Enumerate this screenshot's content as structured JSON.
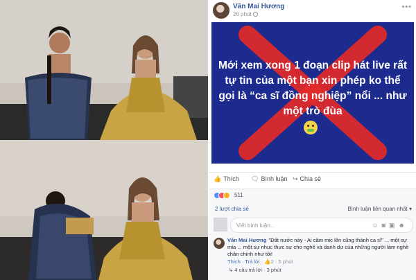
{
  "post": {
    "author": "Văn Mai Hương",
    "time": "26 phút",
    "more": "•••",
    "image_text": "Mới xem xong 1 đoạn clip hát live rất tự tin của một bạn xin phép ko thể gọi là “ca sĩ đồng nghiệp” nổi ... như một trò đùa",
    "colors": {
      "image_bg": "#1d2b8e",
      "x_mark": "#e32a2a"
    }
  },
  "actions": {
    "like": "Thích",
    "comment": "Bình luận",
    "share": "Chia sẻ"
  },
  "reactions": {
    "count": "511"
  },
  "shares": {
    "label": "2 lượt chia sẻ",
    "sort": "Bình luận liên quan nhất ▾"
  },
  "comment_box": {
    "placeholder": "Viết bình luận..."
  },
  "comment": {
    "author": "Văn Mai Hương",
    "text": "\"Đất nước này - Ai cầm mic lên cũng thành ca sĩ\" ... một sự mỉa ... một sự nhục thực sự cho nghề và danh dự của những người làm nghề chân chính như tôi!",
    "like": "Thích",
    "reply": "Trả lời",
    "reacts": "2",
    "time": "5 phút",
    "replies": "4 câu trả lời",
    "replies_time": "3 phút"
  }
}
